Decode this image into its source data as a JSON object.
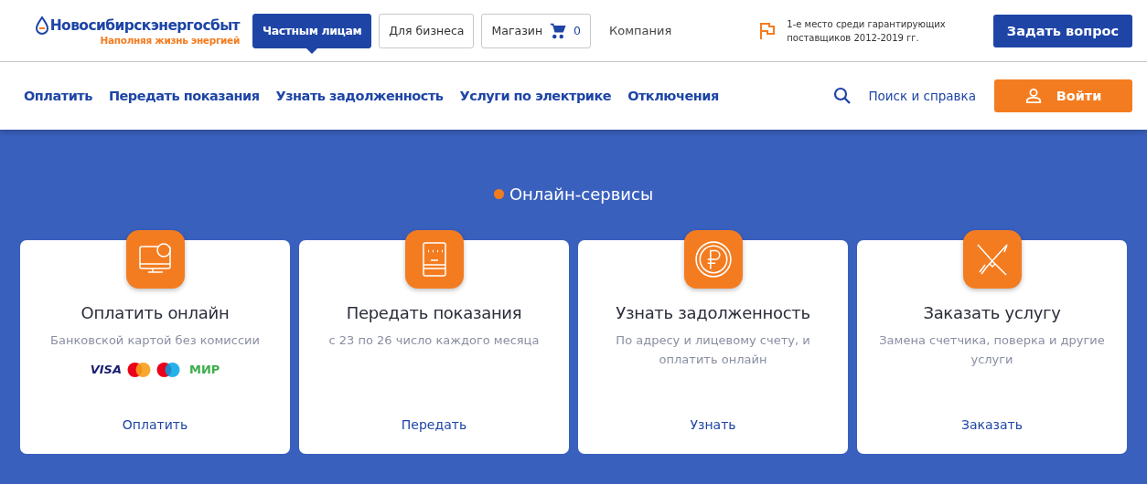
{
  "logo": {
    "name": "Новосибирскэнергосбыт",
    "tagline": "Наполняя жизнь энергией"
  },
  "audience_tabs": [
    {
      "label": "Частным лицам",
      "selected": true
    },
    {
      "label": "Для бизнеса",
      "selected": false
    }
  ],
  "shop": {
    "label": "Магазин",
    "count": "0"
  },
  "company_link": "Компания",
  "award": "1-е место среди гарантирующих поставщиков 2012-2019 гг.",
  "ask_button": "Задать вопрос",
  "nav": [
    "Оплатить",
    "Передать показания",
    "Узнать задолженность",
    "Услуги по электрике",
    "Отключения"
  ],
  "search_link": "Поиск и справка",
  "login_button": "Войти",
  "section_title": "Онлайн-сервисы",
  "cards": [
    {
      "kind": "monitor",
      "title": "Оплатить онлайн",
      "subtitle": "Банковской картой без комиссии",
      "payment_logos": [
        "VISA",
        "МИР"
      ],
      "action": "Оплатить"
    },
    {
      "kind": "meter",
      "title": "Передать показания",
      "subtitle": "с 23 по 26 число каждого месяца",
      "action": "Передать"
    },
    {
      "kind": "ruble",
      "title": "Узнать задолженность",
      "subtitle": "По адресу и лицевому счету, и оплатить онлайн",
      "action": "Узнать"
    },
    {
      "kind": "tools",
      "title": "Заказать услугу",
      "subtitle": "Замена счетчика, поверка и другие услуги",
      "action": "Заказать"
    }
  ]
}
